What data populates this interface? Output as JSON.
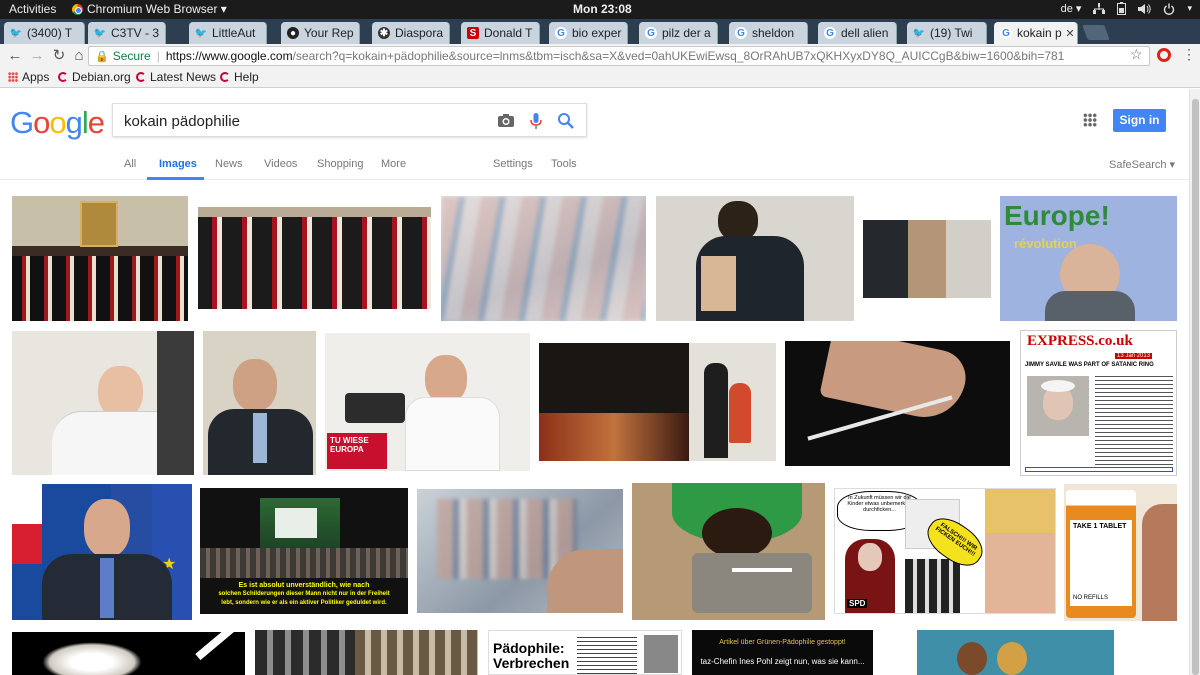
{
  "system_bar": {
    "activities": "Activities",
    "app_name": "Chromium Web Browser ▾",
    "clock": "Mon 23:08",
    "keyboard_layout": "de ▾",
    "tray_icons": [
      "network-icon",
      "battery-icon",
      "volume-icon",
      "power-icon"
    ]
  },
  "tabs": [
    {
      "label": "(3400) T",
      "favicon": "twitter-icon"
    },
    {
      "label": "C3TV - 3",
      "favicon": "twitter-icon"
    },
    {
      "label": "LittleAut",
      "favicon": "twitter-icon"
    },
    {
      "label": "Your Rep",
      "favicon": "github-icon"
    },
    {
      "label": "Diaspora",
      "favicon": "diaspora-icon"
    },
    {
      "label": "Donald T",
      "favicon": "s-icon"
    },
    {
      "label": "bio exper",
      "favicon": "google-icon"
    },
    {
      "label": "pilz der a",
      "favicon": "google-icon"
    },
    {
      "label": "sheldon",
      "favicon": "google-icon"
    },
    {
      "label": "dell alien",
      "favicon": "google-icon"
    },
    {
      "label": "(19) Twi",
      "favicon": "twitter-icon"
    },
    {
      "label": "kokain p",
      "favicon": "google-icon",
      "active": true
    }
  ],
  "toolbar": {
    "secure_label": "Secure",
    "url_host": "https://www.google.com",
    "url_path": "/search?q=kokain+pädophilie&source=lnms&tbm=isch&sa=X&ved=0ahUKEwiEwsq_8OrRAhUB7xQKHXyxDY8Q_AUICCgB&biw=1600&bih=781"
  },
  "bookmarks": [
    {
      "label": "Apps",
      "icon": "apps-grid-icon"
    },
    {
      "label": "Debian.org",
      "icon": "debian-icon"
    },
    {
      "label": "Latest News",
      "icon": "debian-icon"
    },
    {
      "label": "Help",
      "icon": "debian-icon"
    }
  ],
  "google": {
    "logo": "Google",
    "query": "kokain pädophilie",
    "signin_label": "Sign in",
    "nav": {
      "all": "All",
      "images": "Images",
      "news": "News",
      "videos": "Videos",
      "shopping": "Shopping",
      "more": "More",
      "settings": "Settings",
      "tools": "Tools",
      "safesearch": "SafeSearch ▾"
    },
    "image_captions": {
      "subtitle_1": "Es ist absolut unverständlich, wie nach",
      "subtitle_2": "solchen Schilderungen dieser Mann nicht nur in der Freiheit",
      "subtitle_3": "lebt, sondern wie er als ein aktiver Politiker geduldet wird.",
      "europe": "Europe!",
      "revolution": "révolution",
      "express_logo": "EXPRESS.co.uk",
      "express_headline": "JIMMY SAVILE WAS PART OF SATANIC RING",
      "express_date": "13 Jan 2013",
      "meme_1": "In Zukunft müssen wir die Kinder etwas unbemerkter durchficken...",
      "meme_2": "FALSCH!!! WIR FICKEN EUCH!!!",
      "meme_spd": "SPD",
      "pill_label": "TAKE 1 TABLET",
      "pill_refills": "NO REFILLS",
      "spd_podium": "TU WIESE EUROPA",
      "news_headline": "Pädophile: Verbrechen",
      "dark_1": "Artikel über Grünen-Pädophilie gestoppt!",
      "dark_2": "taz-Chefin Ines Pohl zeigt nun, was sie kann..."
    }
  }
}
